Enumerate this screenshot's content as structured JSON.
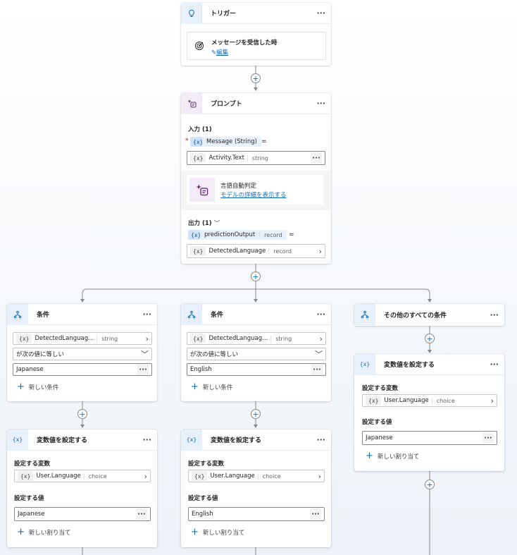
{
  "trigger": {
    "title": "トリガー",
    "more": "···",
    "event_label": "メッセージを受信した時",
    "edit_link": "編集"
  },
  "prompt": {
    "title": "プロンプト",
    "more": "···",
    "input_label": "入力 (1)",
    "input_param": "Message (String)",
    "input_value_name": "Activity.Text",
    "input_value_type": "string",
    "model_name": "言語自動判定",
    "model_link": "モデルの詳細を表示する",
    "output_label": "出力 (1)",
    "output_var": "predictionOutput",
    "output_var_type": "record",
    "output_value_name": "DetectedLanguage",
    "output_value_type": "record"
  },
  "var_icon": "{x}",
  "equals": "=",
  "required_mark": "*",
  "conditions": [
    {
      "title": "条件",
      "var_name": "DetectedLanguag...",
      "var_type": "string",
      "operator": "が次の値に等しい",
      "value": "Japanese",
      "add_condition": "新しい条件"
    },
    {
      "title": "条件",
      "var_name": "DetectedLanguag...",
      "var_type": "string",
      "operator": "が次の値に等しい",
      "value": "English",
      "add_condition": "新しい条件"
    }
  ],
  "other_conditions": {
    "title": "その他のすべての条件"
  },
  "set_vars": [
    {
      "title": "変数値を設定する",
      "var_label": "設定する変数",
      "var_name": "User.Language",
      "var_type": "choice",
      "value_label": "設定する値",
      "value": "Japanese",
      "add_assign": "新しい割り当て"
    },
    {
      "title": "変数値を設定する",
      "var_label": "設定する変数",
      "var_name": "User.Language",
      "var_type": "choice",
      "value_label": "設定する値",
      "value": "English",
      "add_assign": "新しい割り当て"
    },
    {
      "title": "変数値を設定する",
      "var_label": "設定する変数",
      "var_name": "User.Language",
      "var_type": "choice",
      "value_label": "設定する値",
      "value": "Japanese",
      "add_assign": "新しい割り当て"
    }
  ],
  "icons": {
    "trigger": "lightbulb-icon",
    "message": "target-icon",
    "edit": "pencil-icon",
    "prompt": "sparkle-icon",
    "condition": "branch-icon",
    "variable": "variable-icon",
    "add": "plus-icon",
    "more": "ellipsis-icon",
    "chevron": "chevron-right-icon"
  },
  "colors": {
    "accent": "#0f6cbd",
    "prompt_purple": "#6b2f7d",
    "required": "#c50f1f"
  }
}
